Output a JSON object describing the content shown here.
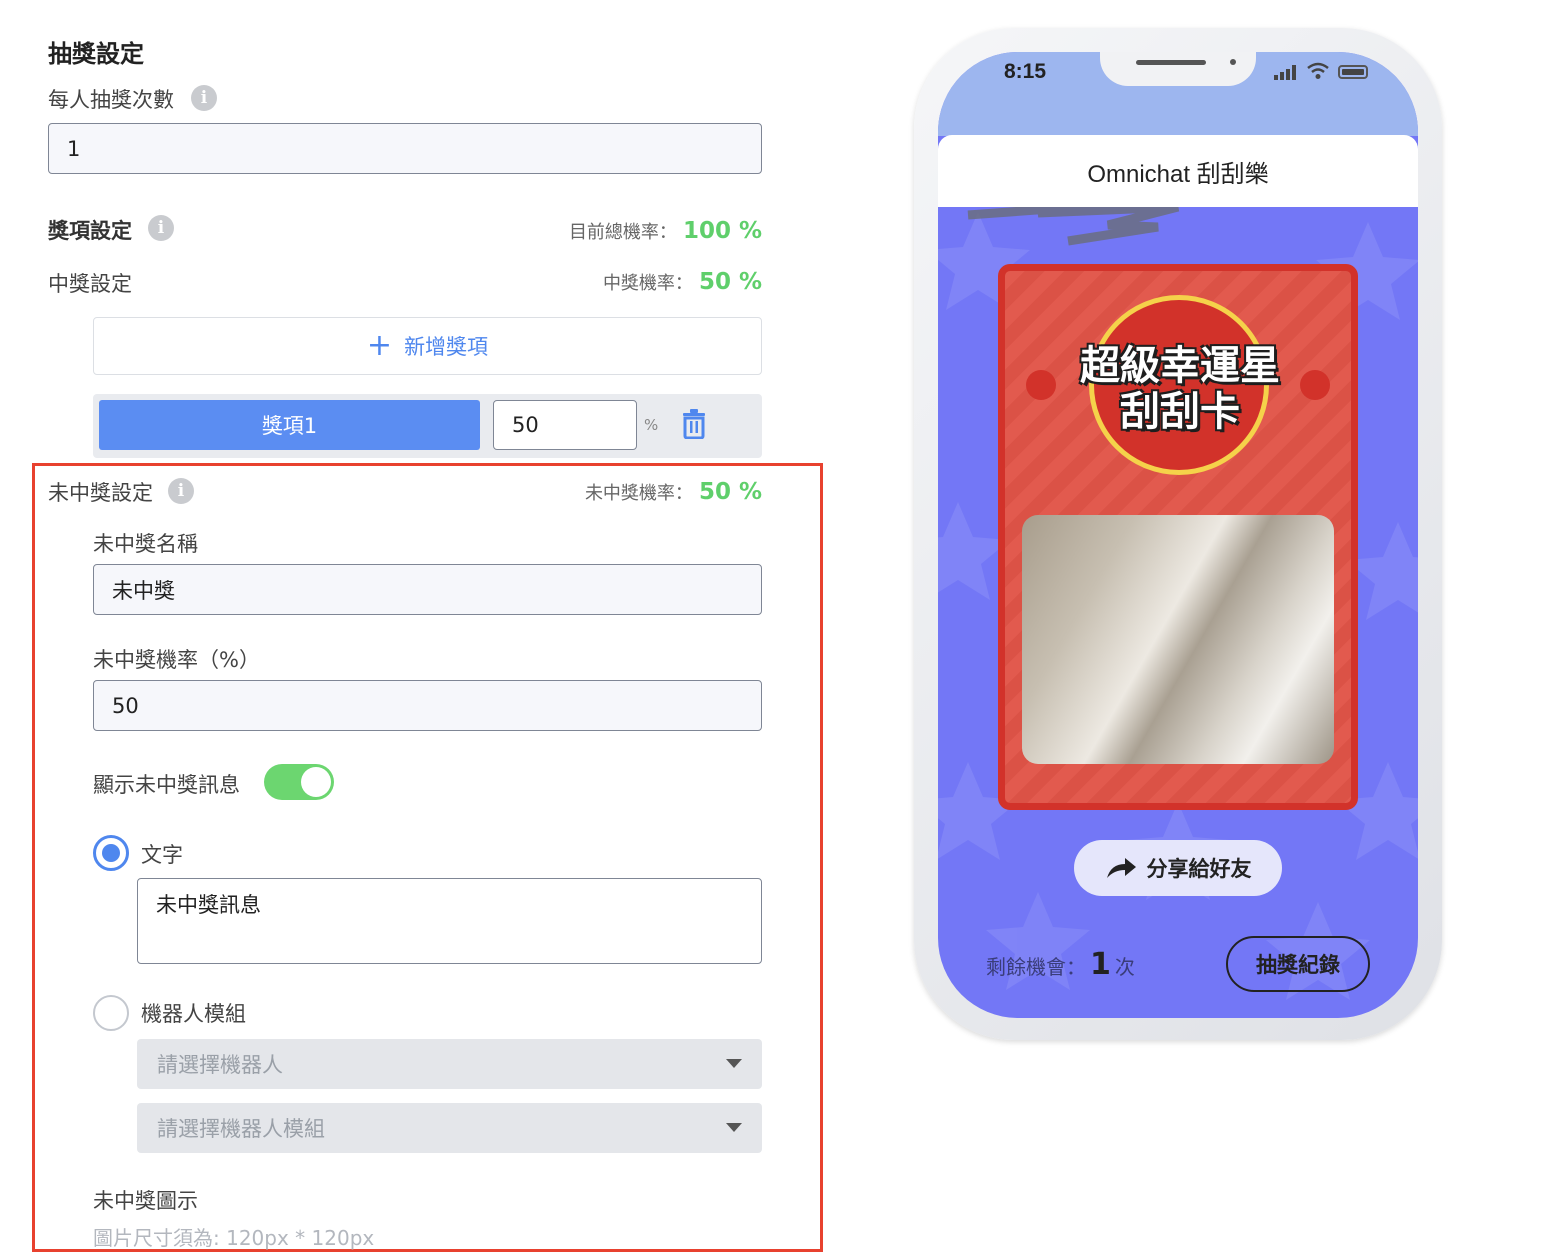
{
  "draw_settings": {
    "title": "抽獎設定",
    "per_person_label": "每人抽獎次數",
    "per_person_value": "1"
  },
  "prize_settings": {
    "title": "獎項設定",
    "total_rate_label": "目前總機率：",
    "total_rate_value": "100 %",
    "win_title": "中獎設定",
    "win_rate_label": "中獎機率：",
    "win_rate_value": "50 %",
    "add_prize_label": "新增獎項",
    "prizes": [
      {
        "name": "獎項1",
        "rate": "50",
        "unit": "%"
      }
    ]
  },
  "no_prize": {
    "title": "未中獎設定",
    "rate_label": "未中獎機率：",
    "rate_value": "50 %",
    "name_label": "未中獎名稱",
    "name_value": "未中獎",
    "prob_label": "未中獎機率（%）",
    "prob_value": "50",
    "show_message_label": "顯示未中獎訊息",
    "show_message_on": true,
    "option_text_label": "文字",
    "message_value": "未中獎訊息",
    "option_bot_label": "機器人模組",
    "select_bot_placeholder": "請選擇機器人",
    "select_module_placeholder": "請選擇機器人模組",
    "icon_label": "未中獎圖示",
    "icon_hint": "圖片尺寸須為: 120px * 120px"
  },
  "phone": {
    "time": "8:15",
    "app_title": "Omnichat 刮刮樂",
    "card_title_line1": "超級幸運星",
    "card_title_line2": "刮刮卡",
    "share_label": "分享給好友",
    "remaining_label": "剩餘機會：",
    "remaining_count": "1",
    "remaining_unit": "次",
    "history_label": "抽獎紀錄"
  },
  "colors": {
    "accent_blue": "#4f87ee",
    "rate_green": "#5fcf6b",
    "highlight_red": "#e8412f",
    "phone_bg": "#7377f6",
    "card_red": "#e2574c"
  }
}
